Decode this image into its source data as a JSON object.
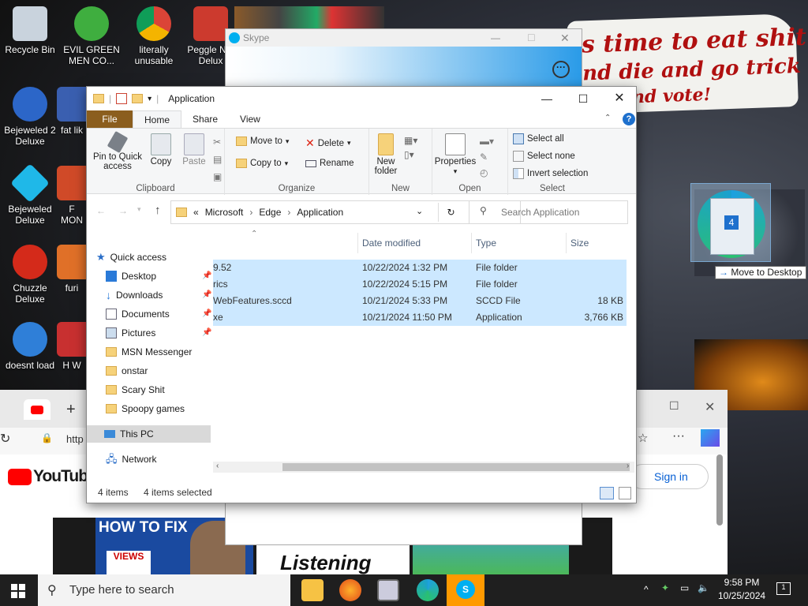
{
  "desktop": {
    "icons": [
      {
        "label": "Recycle Bin",
        "color": "#c9d3dd"
      },
      {
        "label": "EVIL GREEN MEN CO...",
        "color": "#3fae3f"
      },
      {
        "label": "literally unusable",
        "color": "#e8b320"
      },
      {
        "label": "Peggle N... Delux",
        "color": "#cc3a2e"
      },
      {
        "label": "Bejeweled 2 Deluxe",
        "color": "#2c66c8"
      },
      {
        "label": "fat lik",
        "color": "#3a5fb0"
      },
      {
        "label": "Bejeweled Deluxe",
        "color": "#1fb8e8"
      },
      {
        "label": "F MON",
        "color": "#d04a28"
      },
      {
        "label": "Chuzzle Deluxe",
        "color": "#d42a1a"
      },
      {
        "label": "furi",
        "color": "#e07028"
      },
      {
        "label": "doesnt load",
        "color": "#2f7fd8"
      },
      {
        "label": "H W",
        "color": "#c83030"
      }
    ],
    "speech_lines": [
      "s time to eat shit",
      "nd die and go trick",
      "ing and vote!"
    ]
  },
  "skype": {
    "title": "Skype",
    "more": "···"
  },
  "browser": {
    "tab_icon": "youtube-icon",
    "address": "http",
    "youtube": "YouTube",
    "signin": "Sign in",
    "thumb1_title": "HOW TO FIX",
    "thumb1_badge": "VIEWS",
    "thumb2_title": "Listening"
  },
  "explorer": {
    "title": "Application",
    "tabs": [
      "File",
      "Home",
      "Share",
      "View"
    ],
    "ribbon": {
      "clipboard": {
        "pin": "Pin to Quick access",
        "copy": "Copy",
        "paste": "Paste",
        "label": "Clipboard"
      },
      "organize": {
        "move_to": "Move to",
        "copy_to": "Copy to",
        "delete": "Delete",
        "rename": "Rename",
        "label": "Organize"
      },
      "new": {
        "new_folder": "New folder",
        "label": "New"
      },
      "open": {
        "properties": "Properties",
        "label": "Open"
      },
      "select": {
        "select_all": "Select all",
        "select_none": "Select none",
        "invert": "Invert selection",
        "label": "Select"
      }
    },
    "breadcrumb": [
      "«",
      "Microsoft",
      "Edge",
      "Application"
    ],
    "search_placeholder": "Search Application",
    "nav": [
      {
        "label": "Quick access",
        "icon": "star-icon"
      },
      {
        "label": "Desktop",
        "icon": "desktop-icon",
        "pinned": true
      },
      {
        "label": "Downloads",
        "icon": "download-icon",
        "pinned": true
      },
      {
        "label": "Documents",
        "icon": "documents-icon",
        "pinned": true
      },
      {
        "label": "Pictures",
        "icon": "pictures-icon",
        "pinned": true
      },
      {
        "label": "MSN Messenger",
        "icon": "folder-icon"
      },
      {
        "label": "onstar",
        "icon": "folder-icon"
      },
      {
        "label": "Scary Shit",
        "icon": "folder-icon"
      },
      {
        "label": "Spoopy games",
        "icon": "folder-icon"
      },
      {
        "label": "This PC",
        "icon": "pc-icon"
      },
      {
        "label": "Network",
        "icon": "network-icon"
      }
    ],
    "columns": [
      "Date modified",
      "Type",
      "Size"
    ],
    "rows": [
      {
        "name": "9.52",
        "date": "10/22/2024 1:32 PM",
        "type": "File folder",
        "size": ""
      },
      {
        "name": "rics",
        "date": "10/22/2024 5:15 PM",
        "type": "File folder",
        "size": ""
      },
      {
        "name": "WebFeatures.sccd",
        "date": "10/21/2024 5:33 PM",
        "type": "SCCD File",
        "size": "18 KB"
      },
      {
        "name": "xe",
        "date": "10/21/2024 11:50 PM",
        "type": "Application",
        "size": "3,766 KB"
      }
    ],
    "status_items": "4 items",
    "status_selected": "4 items selected"
  },
  "drag": {
    "count": "4",
    "tip": "Move to Desktop"
  },
  "taskbar": {
    "search_placeholder": "Type here to search",
    "time": "9:58 PM",
    "date": "10/25/2024",
    "notifications": "1"
  }
}
